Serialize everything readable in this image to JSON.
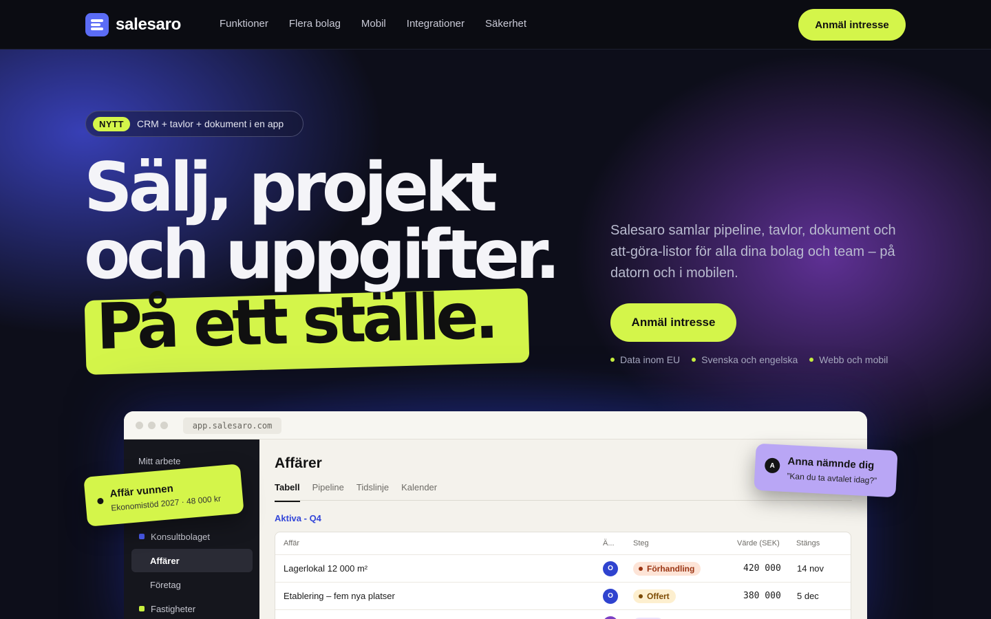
{
  "header": {
    "brand": "salesaro",
    "nav": [
      "Funktioner",
      "Flera bolag",
      "Mobil",
      "Integrationer",
      "Säkerhet"
    ],
    "cta": "Anmäl intresse"
  },
  "hero": {
    "badge": "NYTT",
    "badge_text": "CRM + tavlor + dokument i en app",
    "headline_1": "Sälj, projekt",
    "headline_2": "och uppgifter.",
    "headline_highlight": "På ett ställe.",
    "lead": "Salesaro samlar pipeline, tavlor, dokument och att-göra-listor för alla dina bolag och team – på datorn och i mobilen.",
    "cta": "Anmäl intresse",
    "features": [
      "Data inom EU",
      "Svenska och engelska",
      "Webb och mobil"
    ]
  },
  "app": {
    "url": "app.salesaro.com",
    "sidebar": {
      "section": "Mitt arbete",
      "items": [
        {
          "label": "Konsultbolaget",
          "color": "#4b5cf0"
        },
        {
          "label": "Affärer"
        },
        {
          "label": "Företag"
        },
        {
          "label": "Fastigheter",
          "color": "#c8ef3e"
        }
      ]
    },
    "main": {
      "title": "Affärer",
      "tabs": [
        "Tabell",
        "Pipeline",
        "Tidslinje",
        "Kalender"
      ],
      "group": "Aktiva - Q4",
      "columns": [
        "Affär",
        "Ä...",
        "Steg",
        "Värde (SEK)",
        "Stängs"
      ],
      "rows": [
        {
          "deal": "Lagerlokal 12 000 m²",
          "owner": "O",
          "stage": "Förhandling",
          "value": "420 000",
          "close": "14 nov"
        },
        {
          "deal": "Etablering – fem nya platser",
          "owner": "O",
          "stage": "Offert",
          "value": "380 000",
          "close": "5 dec"
        }
      ]
    }
  },
  "cards": {
    "won_title": "Affär vunnen",
    "won_sub": "Ekonomistöd 2027 · 48 000 kr",
    "mention_avatar": "A",
    "mention_title": "Anna nämnde dig",
    "mention_sub": "”Kan du ta avtalet idag?”"
  },
  "colors": {
    "accent": "#d4f54a",
    "brand": "#5b6cf5",
    "stage_negotiation": "#fde4d7",
    "stage_offer": "#fdefcf"
  }
}
